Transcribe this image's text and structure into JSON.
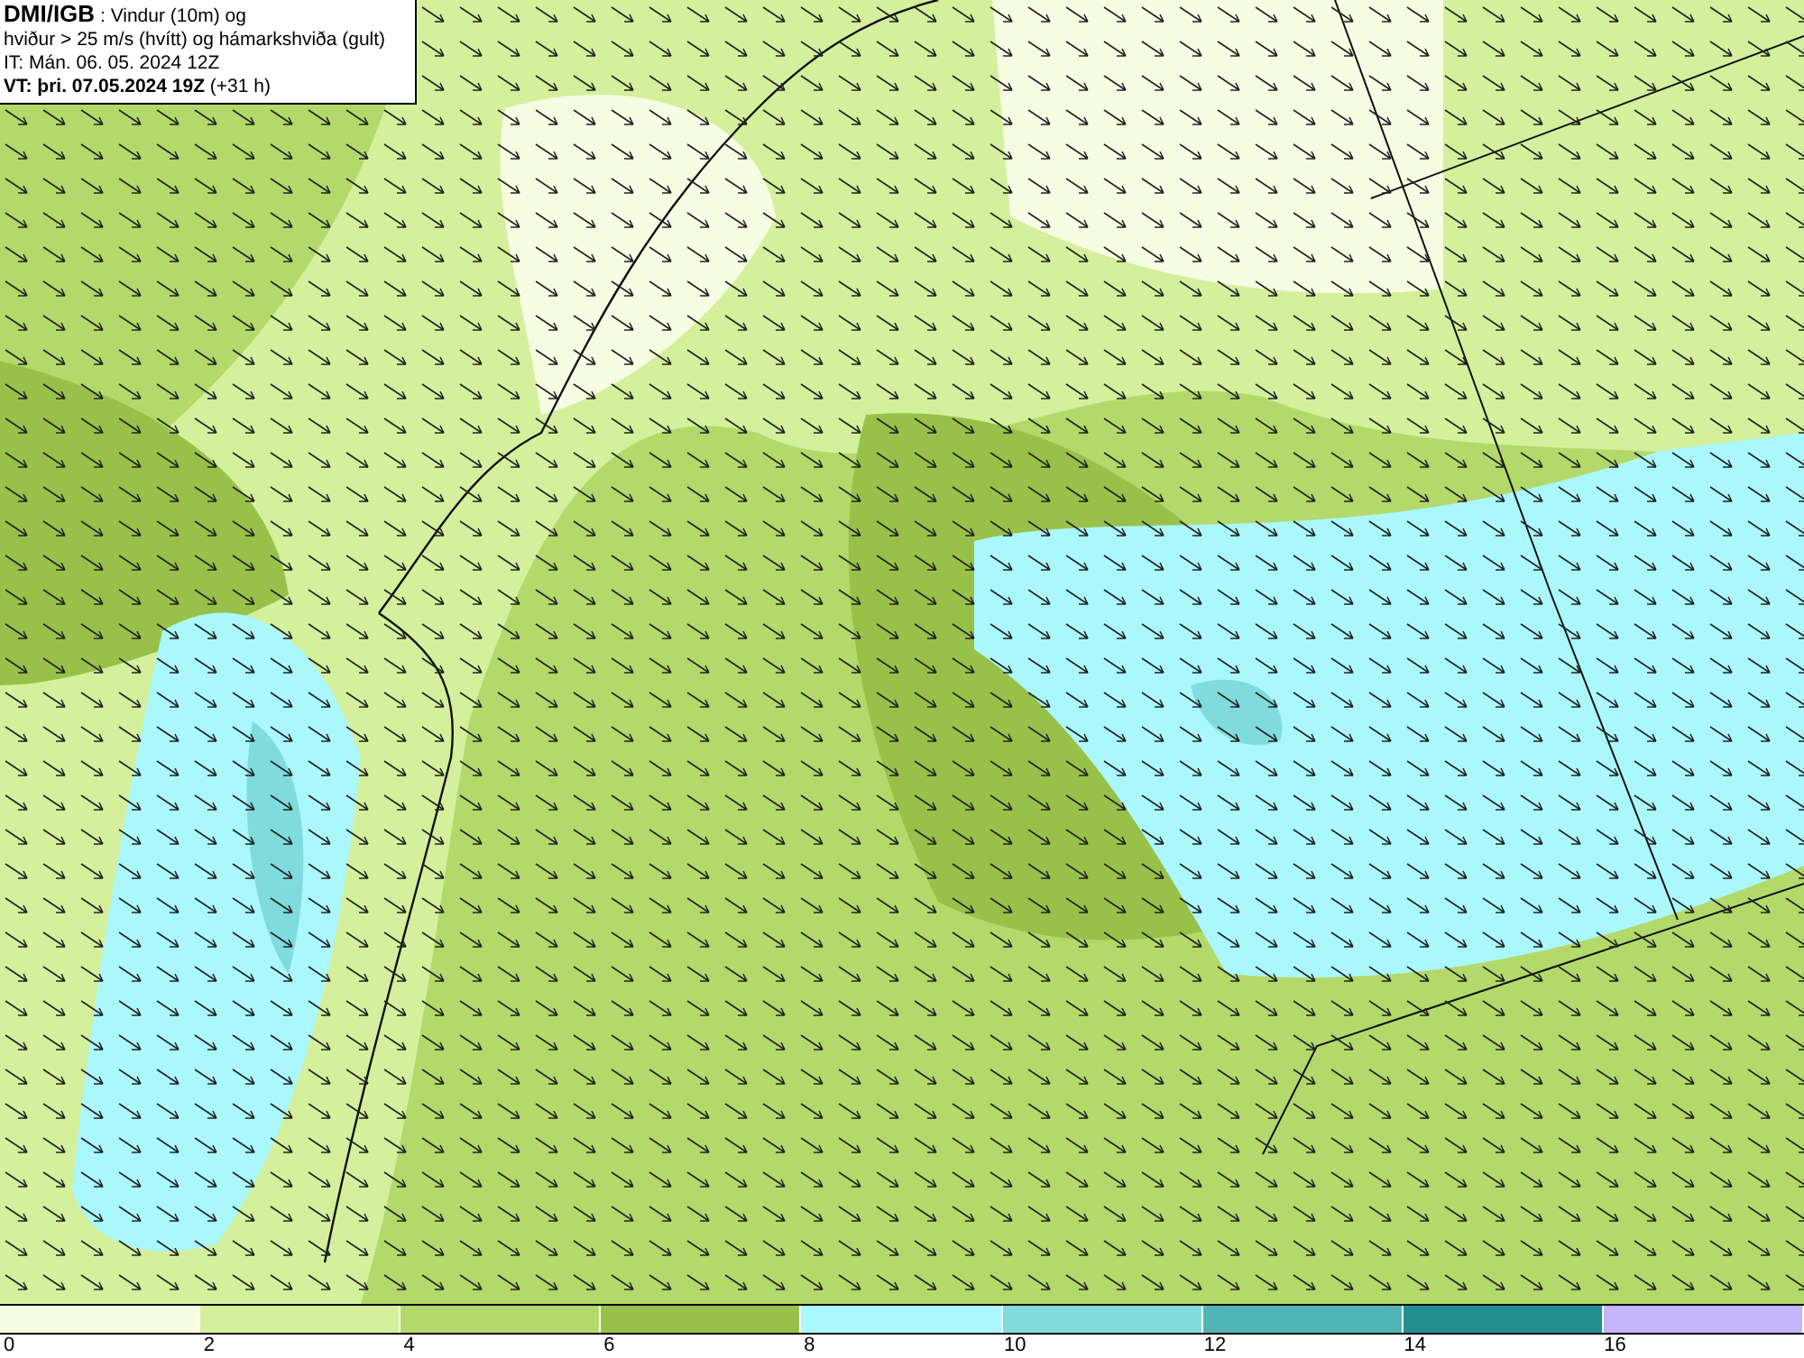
{
  "title_box": {
    "lines": [
      "**DMI/IGB** : Vindur (10m) og",
      "hviður > 25 m/s (hvítt) og hámarkshviða (gult)",
      "IT: Mán. 06. 05. 2024 12Z",
      "**VT: þri. 07.05.2024 19Z** (+31 h)"
    ]
  },
  "legend": {
    "items": [
      {
        "color": "#f7fde3",
        "label": "0"
      },
      {
        "color": "#d4f09c",
        "label": "2"
      },
      {
        "color": "#b3d96b",
        "label": "4"
      },
      {
        "color": "#98c14a",
        "label": "6"
      },
      {
        "color": "#aaf8fc",
        "label": "8"
      },
      {
        "color": "#80dcdc",
        "label": "10"
      },
      {
        "color": "#52b5b5",
        "label": "12"
      },
      {
        "color": "#218f8f",
        "label": "14"
      },
      {
        "color": "#c4b4fa",
        "label": "16"
      }
    ]
  }
}
